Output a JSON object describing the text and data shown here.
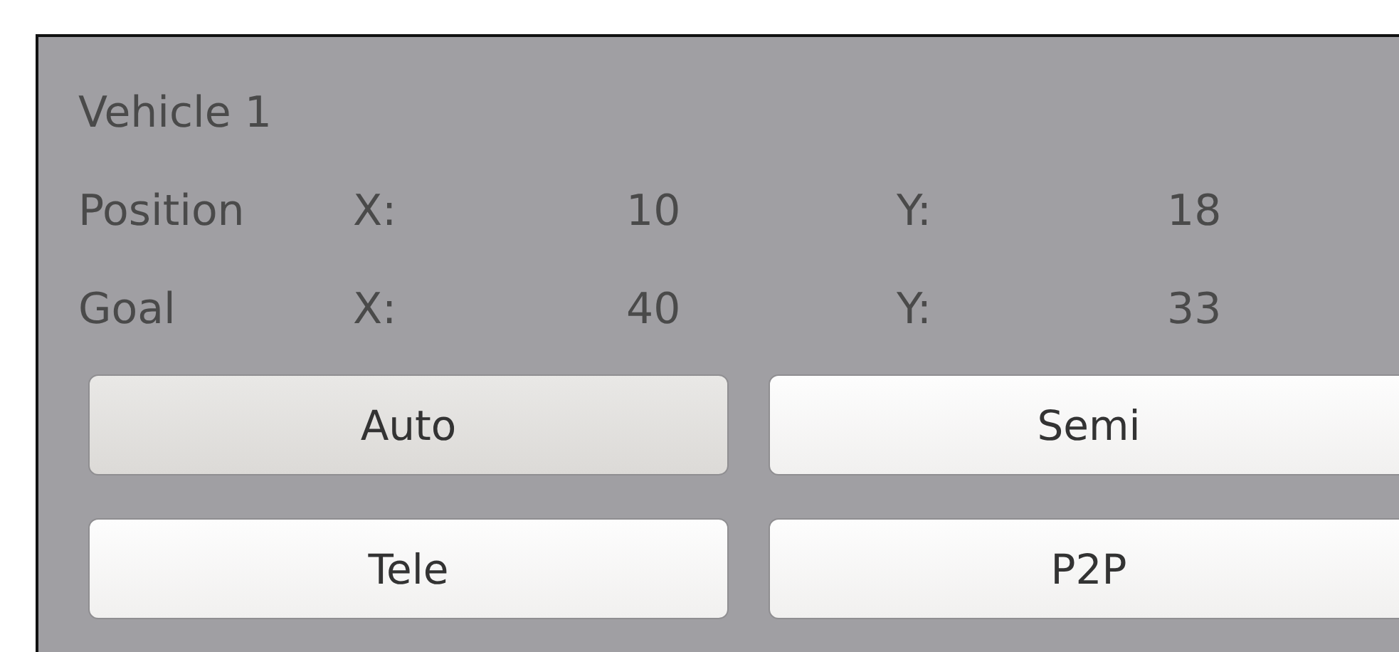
{
  "panel": {
    "title": "Vehicle 1",
    "rows": [
      {
        "label": "Position",
        "x_label": "X:",
        "x_value": "10",
        "y_label": "Y:",
        "y_value": "18"
      },
      {
        "label": "Goal",
        "x_label": "X:",
        "x_value": "40",
        "y_label": "Y:",
        "y_value": "33"
      }
    ],
    "buttons": [
      {
        "label": "Auto",
        "selected": true
      },
      {
        "label": "Semi",
        "selected": false
      },
      {
        "label": "Tele",
        "selected": false
      },
      {
        "label": "P2P",
        "selected": false
      }
    ]
  }
}
